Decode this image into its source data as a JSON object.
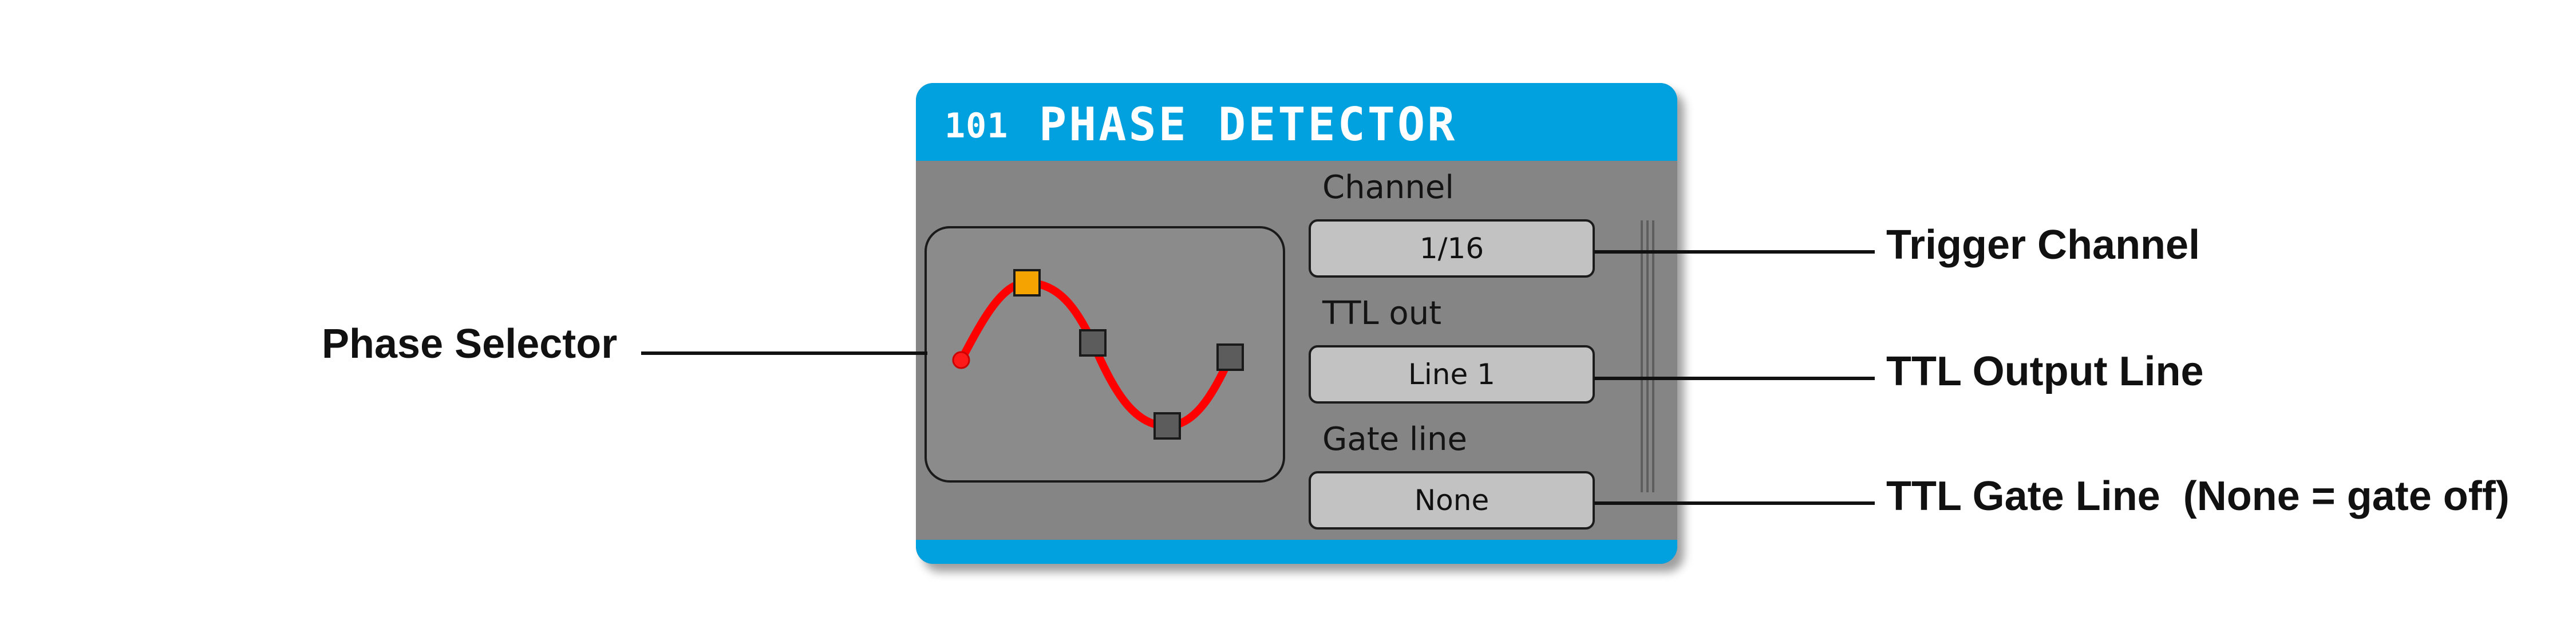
{
  "panel": {
    "node_id": "101",
    "title": "PHASE DETECTOR",
    "accent_color": "#00a1de",
    "body_color": "#858585"
  },
  "phase_selector": {
    "wave_color": "#ff0000",
    "selected_color": "#f5a300",
    "handle_color": "#5c5c5c",
    "selected_handle": "peak"
  },
  "parameters": {
    "channel": {
      "label": "Channel",
      "value": "1/16"
    },
    "ttl_out": {
      "label": "TTL out",
      "value": "Line 1"
    },
    "gate_line": {
      "label": "Gate line",
      "value": "None"
    }
  },
  "annotations": {
    "phase_selector": "Phase Selector",
    "trigger_channel": "Trigger Channel",
    "ttl_output_line": "TTL Output Line",
    "ttl_gate_line": "TTL Gate Line  (None = gate off)"
  }
}
